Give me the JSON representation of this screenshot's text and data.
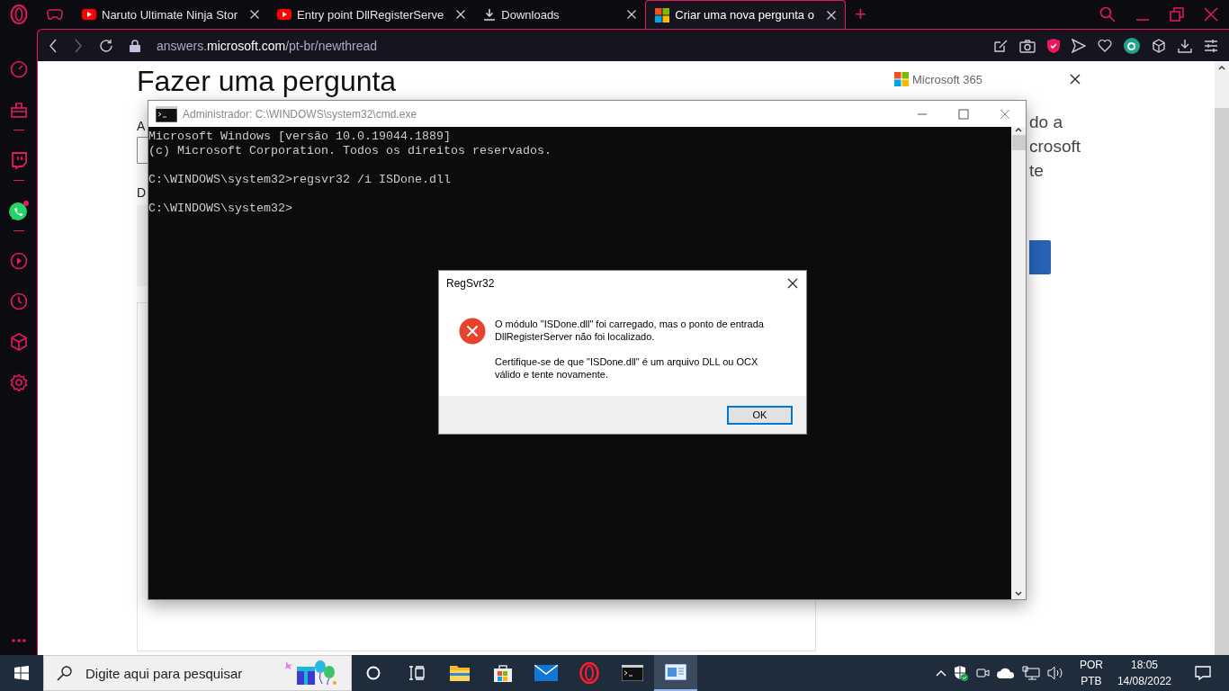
{
  "browser": {
    "tabs": [
      {
        "kind": "game",
        "selected": false
      },
      {
        "kind": "youtube",
        "title": "Naruto Ultimate Ninja Stor",
        "selected": false
      },
      {
        "kind": "youtube",
        "title": "Entry point DllRegisterServe",
        "selected": false
      },
      {
        "kind": "download",
        "title": "Downloads",
        "selected": false
      },
      {
        "kind": "microsoft",
        "title": "Criar uma nova pergunta o",
        "selected": true
      }
    ],
    "new_tab": "+",
    "url": {
      "subdomain": "answers.",
      "domain": "microsoft.com",
      "path": "/pt-br/newthread"
    },
    "sidebar": [
      {
        "kind": "speed"
      },
      {
        "kind": "bag"
      },
      {
        "kind": "twitch",
        "divider": true
      },
      {
        "kind": "whatsapp",
        "badge": true,
        "divider": true
      },
      {
        "kind": "player",
        "divider": true
      },
      {
        "kind": "clock"
      },
      {
        "kind": "cube"
      },
      {
        "kind": "gear"
      }
    ]
  },
  "page": {
    "heading": "Fazer uma pergunta",
    "label_1": "A",
    "label_2": "D",
    "promo": {
      "brand": "Microsoft 365",
      "lines": [
        "do a",
        "crosoft",
        "te"
      ]
    }
  },
  "cmd": {
    "title": "Administrador: C:\\WINDOWS\\system32\\cmd.exe",
    "blocks": [
      [
        "Microsoft Windows [versão 10.0.19044.1889]",
        "(c) Microsoft Corporation. Todos os direitos reservados."
      ],
      [
        "C:\\WINDOWS\\system32>regsvr32 /i ISDone.dll"
      ],
      [
        "C:\\WINDOWS\\system32>"
      ]
    ]
  },
  "dialog": {
    "title": "RegSvr32",
    "paragraphs": [
      "O módulo \"ISDone.dll\" foi carregado, mas o ponto de entrada DllRegisterServer não foi localizado.",
      "Certifique-se de que \"ISDone.dll\" é um arquivo DLL ou OCX válido e tente novamente."
    ],
    "button": "OK"
  },
  "taskbar": {
    "search": {
      "placeholder": "Digite aqui para pesquisar"
    },
    "apps": [
      {
        "kind": "explorer",
        "selected": false
      },
      {
        "kind": "store",
        "selected": false
      },
      {
        "kind": "mail",
        "selected": false
      },
      {
        "kind": "opera",
        "selected": false
      },
      {
        "kind": "cmd",
        "selected": false
      },
      {
        "kind": "regsvr",
        "selected": true
      }
    ],
    "language": [
      "POR",
      "PTB"
    ],
    "time": "18:05",
    "date": "14/08/2022"
  }
}
